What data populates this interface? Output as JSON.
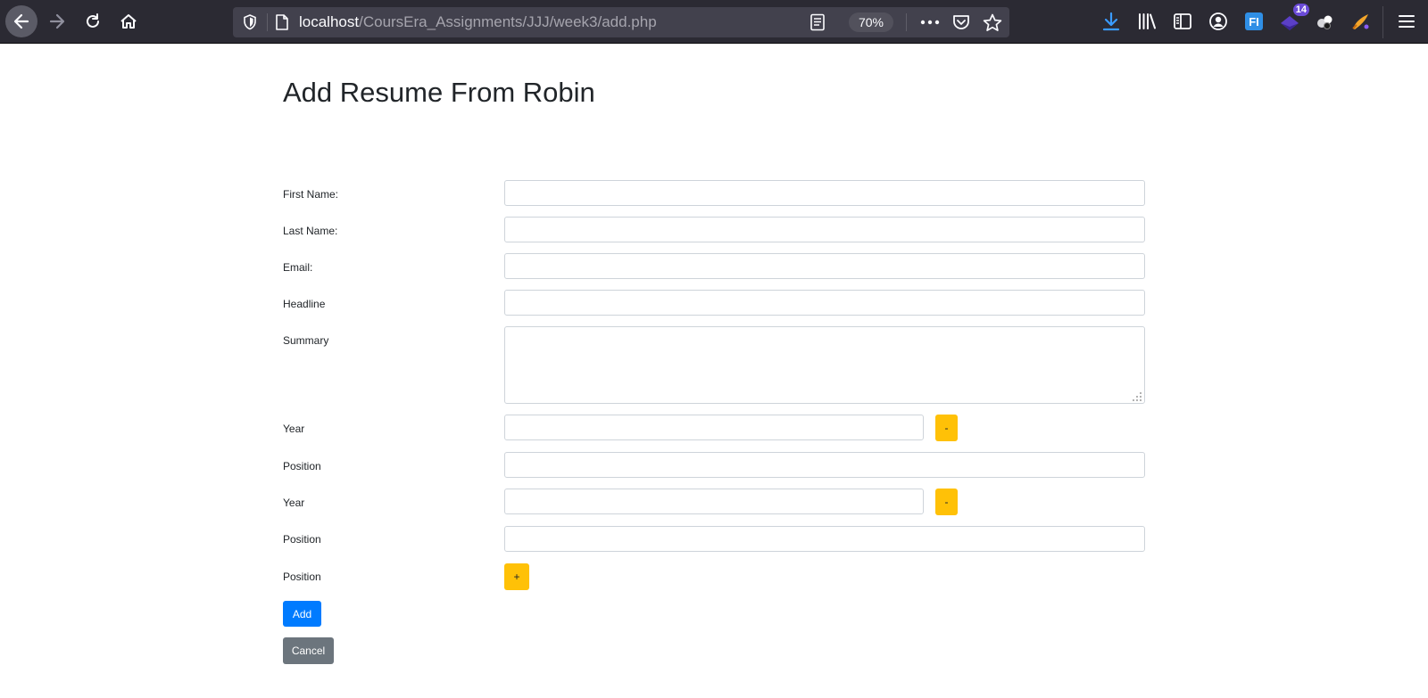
{
  "browser": {
    "url_host": "localhost",
    "url_path": "/CoursEra_Assignments/JJJ/week3/add.php",
    "zoom": "70%",
    "extension_badge": "14",
    "extension_icon_label": "FI"
  },
  "page": {
    "title": "Add Resume From Robin"
  },
  "form": {
    "first_name_label": "First Name:",
    "last_name_label": "Last Name:",
    "email_label": "Email:",
    "headline_label": "Headline",
    "summary_label": "Summary",
    "positions": [
      {
        "year_label": "Year",
        "year_value": "",
        "position_label": "Position",
        "position_value": "",
        "remove_label": "-"
      },
      {
        "year_label": "Year",
        "year_value": "",
        "position_label": "Position",
        "position_value": "",
        "remove_label": "-"
      }
    ],
    "add_position_label": "Position",
    "add_position_button": "+",
    "add_button": "Add",
    "cancel_button": "Cancel"
  },
  "colors": {
    "warning": "#ffc107",
    "primary": "#007bff",
    "secondary": "#6c757d",
    "toolbar": "#2b2a33"
  }
}
